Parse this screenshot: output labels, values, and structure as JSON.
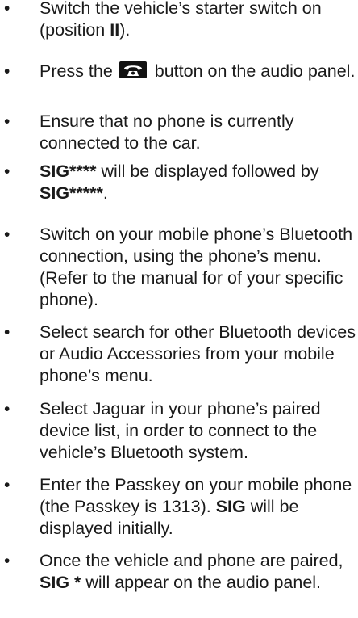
{
  "steps": [
    {
      "parts": [
        {
          "t": "Switch the vehicle’s starter switch on (position "
        },
        {
          "t": "II",
          "b": true
        },
        {
          "t": ")."
        }
      ]
    },
    {
      "parts": [
        {
          "t": "Press the "
        },
        {
          "icon": "phone-handset-icon"
        },
        {
          "t": " button on the audio panel."
        }
      ]
    },
    {
      "parts": [
        {
          "t": "Ensure that no phone is currently connected to the car."
        }
      ]
    },
    {
      "parts": [
        {
          "t": "SIG****",
          "b": true
        },
        {
          "t": " will be displayed followed by "
        },
        {
          "t": "SIG*****",
          "b": true
        },
        {
          "t": "."
        }
      ]
    },
    {
      "parts": [
        {
          "t": "Switch on your mobile phone’s Bluetooth connection, using the phone’s menu. (Refer to the manual for of your specific phone)."
        }
      ]
    },
    {
      "parts": [
        {
          "t": "Select search for other Bluetooth devices or Audio Accessories from your mobile phone’s menu."
        }
      ]
    },
    {
      "parts": [
        {
          "t": "Select Jaguar in your phone’s paired device list, in order to connect to the vehicle’s Bluetooth system."
        }
      ]
    },
    {
      "parts": [
        {
          "t": "Enter the Passkey on your mobile phone (the Passkey is 1313). "
        },
        {
          "t": "SIG",
          "b": true
        },
        {
          "t": " will be displayed initially."
        }
      ]
    },
    {
      "parts": [
        {
          "t": "Once the vehicle and phone are paired, "
        },
        {
          "t": "SIG *",
          "b": true
        },
        {
          "t": " will appear on the audio panel."
        }
      ]
    }
  ],
  "bullet_char": "•"
}
